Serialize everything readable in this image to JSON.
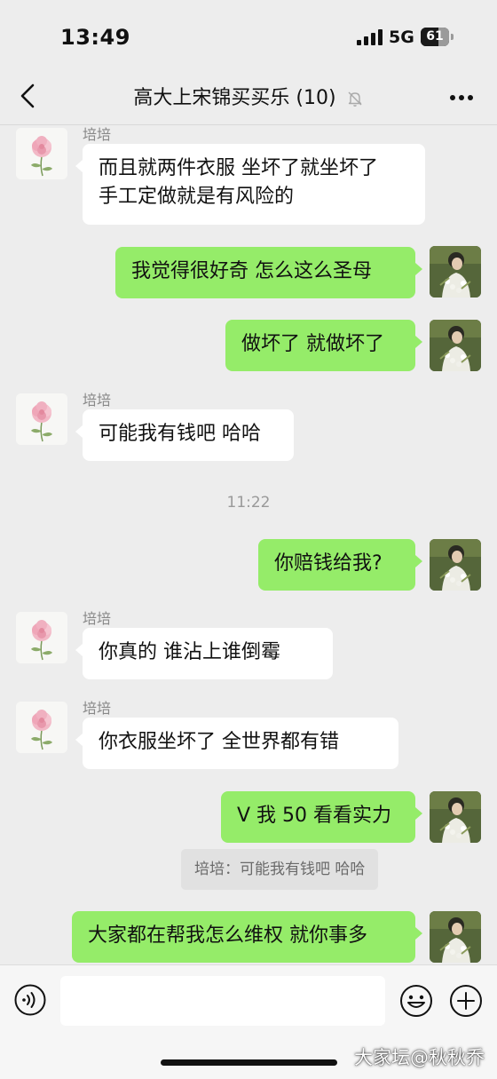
{
  "status_bar": {
    "time": "13:49",
    "network": "5G",
    "battery": "61",
    "battery_level": 0.61
  },
  "navbar": {
    "title": "高大上宋锦买买乐 (10)"
  },
  "messages": [
    {
      "side": "left",
      "sender": "培培",
      "lines": [
        "而且就两件衣服 坐坏了就坐坏了",
        "手工定做就是有风险的"
      ]
    },
    {
      "side": "right",
      "text": "我觉得很好奇 怎么这么圣母"
    },
    {
      "side": "right",
      "text": "做坏了 就做坏了"
    },
    {
      "side": "left",
      "sender": "培培",
      "text": "可能我有钱吧 哈哈"
    },
    {
      "type": "time",
      "text": "11:22"
    },
    {
      "side": "right",
      "text": "你赔钱给我?"
    },
    {
      "side": "left",
      "sender": "培培",
      "text": "你真的  谁沾上谁倒霉"
    },
    {
      "side": "left",
      "sender": "培培",
      "text": "你衣服坐坏了  全世界都有错"
    },
    {
      "side": "right",
      "text": "V 我 50 看看实力"
    },
    {
      "type": "quote",
      "text": "培培：可能我有钱吧 哈哈"
    },
    {
      "side": "right",
      "text": "大家都在帮我怎么维权 就你事多"
    }
  ],
  "input_bar": {
    "text_value": ""
  },
  "watermark": "大家坛@秋秋乔",
  "colors": {
    "background": "#ededed",
    "my_bubble": "#95ec69",
    "their_bubble": "#ffffff"
  },
  "icons": [
    "back-icon",
    "mute-bell-icon",
    "more-icon",
    "voice-icon",
    "emoji-icon",
    "plus-icon"
  ]
}
